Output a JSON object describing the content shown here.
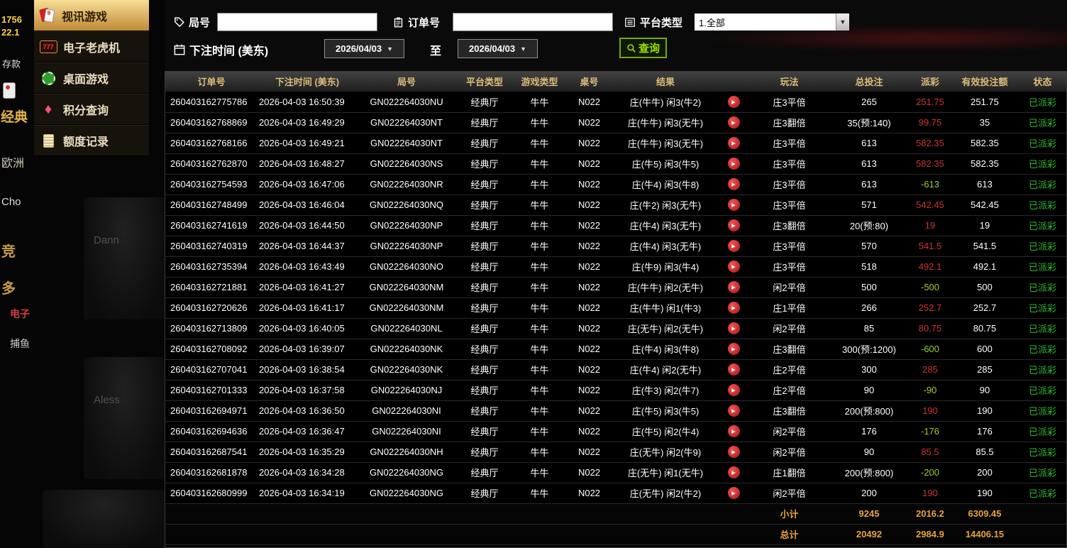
{
  "colors": {
    "gold_accent": "#e9b54d",
    "sidebar_active_gradient_top": "#f8de96",
    "sidebar_active_gradient_bottom": "#bf8a38",
    "header_text": "#dcbd7a",
    "payout_win_red": "#cc3333",
    "payout_loss_green": "#9ccf34",
    "status_paid_green": "#2eb82e",
    "query_button_green": "#6fae00",
    "totals_orange": "#e8a33d"
  },
  "background": {
    "left_strip": [
      {
        "text": "1756"
      },
      {
        "text": "22.1"
      },
      {
        "text": "存款"
      },
      {
        "text": "经典"
      },
      {
        "text": "欧洲"
      },
      {
        "text": "Cho"
      },
      {
        "text": "竞"
      },
      {
        "text": "多"
      },
      {
        "text": "电子"
      },
      {
        "text": "捕鱼"
      }
    ],
    "portraits": [
      {
        "name": "Dann"
      },
      {
        "name": "Aless"
      }
    ]
  },
  "sidebar": {
    "items": [
      {
        "label": "视讯游戏",
        "icon": "cards-icon",
        "active": true
      },
      {
        "label": "电子老虎机",
        "icon": "slot-icon",
        "icon_text": "777",
        "active": false
      },
      {
        "label": "桌面游戏",
        "icon": "chip-icon",
        "active": false
      },
      {
        "label": "积分查询",
        "icon": "diamond-icon",
        "active": false
      },
      {
        "label": "额度记录",
        "icon": "document-icon",
        "active": false
      }
    ]
  },
  "filters": {
    "round_label": "局号",
    "round_value": "",
    "order_label": "订单号",
    "order_value": "",
    "platform_label": "平台类型",
    "platform_selected": "1.全部",
    "bet_time_label": "下注时间 (美东)",
    "date_from": "2026/04/03",
    "to_label": "至",
    "date_to": "2026/04/03",
    "query_label": "查询"
  },
  "table": {
    "headers": [
      "订单号",
      "下注时间 (美东)",
      "局号",
      "平台类型",
      "游戏类型",
      "桌号",
      "结果",
      "",
      "玩法",
      "总投注",
      "派彩",
      "有效投注额",
      "状态"
    ],
    "rows": [
      {
        "order": "260403162775786",
        "time": "2026-04-03 16:50:39",
        "round": "GN022264030NU",
        "platform": "经典厅",
        "game": "牛牛",
        "table_no": "N022",
        "result": "庄(牛牛) 闲3(牛2)",
        "method": "庄3平倍",
        "total_bet": "265",
        "payout": "251.75",
        "valid_bet": "251.75",
        "status": "已派彩"
      },
      {
        "order": "260403162768869",
        "time": "2026-04-03 16:49:29",
        "round": "GN022264030NT",
        "platform": "经典厅",
        "game": "牛牛",
        "table_no": "N022",
        "result": "庄(牛牛) 闲3(无牛)",
        "method": "庄3翻倍",
        "total_bet": "35(预:140)",
        "payout": "99.75",
        "valid_bet": "35",
        "status": "已派彩"
      },
      {
        "order": "260403162768166",
        "time": "2026-04-03 16:49:21",
        "round": "GN022264030NT",
        "platform": "经典厅",
        "game": "牛牛",
        "table_no": "N022",
        "result": "庄(牛牛) 闲3(无牛)",
        "method": "庄3平倍",
        "total_bet": "613",
        "payout": "582.35",
        "valid_bet": "582.35",
        "status": "已派彩"
      },
      {
        "order": "260403162762870",
        "time": "2026-04-03 16:48:27",
        "round": "GN022264030NS",
        "platform": "经典厅",
        "game": "牛牛",
        "table_no": "N022",
        "result": "庄(牛5) 闲3(牛5)",
        "method": "庄3平倍",
        "total_bet": "613",
        "payout": "582.35",
        "valid_bet": "582.35",
        "status": "已派彩"
      },
      {
        "order": "260403162754593",
        "time": "2026-04-03 16:47:06",
        "round": "GN022264030NR",
        "platform": "经典厅",
        "game": "牛牛",
        "table_no": "N022",
        "result": "庄(牛4) 闲3(牛8)",
        "method": "庄3平倍",
        "total_bet": "613",
        "payout": "-613",
        "valid_bet": "613",
        "status": "已派彩"
      },
      {
        "order": "260403162748499",
        "time": "2026-04-03 16:46:04",
        "round": "GN022264030NQ",
        "platform": "经典厅",
        "game": "牛牛",
        "table_no": "N022",
        "result": "庄(牛2) 闲3(无牛)",
        "method": "庄3平倍",
        "total_bet": "571",
        "payout": "542.45",
        "valid_bet": "542.45",
        "status": "已派彩"
      },
      {
        "order": "260403162741619",
        "time": "2026-04-03 16:44:50",
        "round": "GN022264030NP",
        "platform": "经典厅",
        "game": "牛牛",
        "table_no": "N022",
        "result": "庄(牛4) 闲3(无牛)",
        "method": "庄3翻倍",
        "total_bet": "20(预:80)",
        "payout": "19",
        "valid_bet": "19",
        "status": "已派彩"
      },
      {
        "order": "260403162740319",
        "time": "2026-04-03 16:44:37",
        "round": "GN022264030NP",
        "platform": "经典厅",
        "game": "牛牛",
        "table_no": "N022",
        "result": "庄(牛4) 闲3(无牛)",
        "method": "庄3平倍",
        "total_bet": "570",
        "payout": "541.5",
        "valid_bet": "541.5",
        "status": "已派彩"
      },
      {
        "order": "260403162735394",
        "time": "2026-04-03 16:43:49",
        "round": "GN022264030NO",
        "platform": "经典厅",
        "game": "牛牛",
        "table_no": "N022",
        "result": "庄(牛9) 闲3(牛4)",
        "method": "庄3平倍",
        "total_bet": "518",
        "payout": "492.1",
        "valid_bet": "492.1",
        "status": "已派彩"
      },
      {
        "order": "260403162721881",
        "time": "2026-04-03 16:41:27",
        "round": "GN022264030NM",
        "platform": "经典厅",
        "game": "牛牛",
        "table_no": "N022",
        "result": "庄(牛牛) 闲2(无牛)",
        "method": "闲2平倍",
        "total_bet": "500",
        "payout": "-500",
        "valid_bet": "500",
        "status": "已派彩"
      },
      {
        "order": "260403162720626",
        "time": "2026-04-03 16:41:17",
        "round": "GN022264030NM",
        "platform": "经典厅",
        "game": "牛牛",
        "table_no": "N022",
        "result": "庄(牛牛) 闲1(牛3)",
        "method": "庄1平倍",
        "total_bet": "266",
        "payout": "252.7",
        "valid_bet": "252.7",
        "status": "已派彩"
      },
      {
        "order": "260403162713809",
        "time": "2026-04-03 16:40:05",
        "round": "GN022264030NL",
        "platform": "经典厅",
        "game": "牛牛",
        "table_no": "N022",
        "result": "庄(无牛) 闲2(无牛)",
        "method": "闲2平倍",
        "total_bet": "85",
        "payout": "80.75",
        "valid_bet": "80.75",
        "status": "已派彩"
      },
      {
        "order": "260403162708092",
        "time": "2026-04-03 16:39:07",
        "round": "GN022264030NK",
        "platform": "经典厅",
        "game": "牛牛",
        "table_no": "N022",
        "result": "庄(牛4) 闲3(牛8)",
        "method": "庄3翻倍",
        "total_bet": "300(预:1200)",
        "payout": "-600",
        "valid_bet": "600",
        "status": "已派彩"
      },
      {
        "order": "260403162707041",
        "time": "2026-04-03 16:38:54",
        "round": "GN022264030NK",
        "platform": "经典厅",
        "game": "牛牛",
        "table_no": "N022",
        "result": "庄(牛4) 闲2(无牛)",
        "method": "庄2平倍",
        "total_bet": "300",
        "payout": "285",
        "valid_bet": "285",
        "status": "已派彩"
      },
      {
        "order": "260403162701333",
        "time": "2026-04-03 16:37:58",
        "round": "GN022264030NJ",
        "platform": "经典厅",
        "game": "牛牛",
        "table_no": "N022",
        "result": "庄(牛3) 闲2(牛7)",
        "method": "庄2平倍",
        "total_bet": "90",
        "payout": "-90",
        "valid_bet": "90",
        "status": "已派彩"
      },
      {
        "order": "260403162694971",
        "time": "2026-04-03 16:36:50",
        "round": "GN022264030NI",
        "platform": "经典厅",
        "game": "牛牛",
        "table_no": "N022",
        "result": "庄(牛5) 闲3(牛5)",
        "method": "庄3翻倍",
        "total_bet": "200(预:800)",
        "payout": "190",
        "valid_bet": "190",
        "status": "已派彩"
      },
      {
        "order": "260403162694636",
        "time": "2026-04-03 16:36:47",
        "round": "GN022264030NI",
        "platform": "经典厅",
        "game": "牛牛",
        "table_no": "N022",
        "result": "庄(牛5) 闲2(牛4)",
        "method": "闲2平倍",
        "total_bet": "176",
        "payout": "-176",
        "valid_bet": "176",
        "status": "已派彩"
      },
      {
        "order": "260403162687541",
        "time": "2026-04-03 16:35:29",
        "round": "GN022264030NH",
        "platform": "经典厅",
        "game": "牛牛",
        "table_no": "N022",
        "result": "庄(无牛) 闲2(牛9)",
        "method": "闲2平倍",
        "total_bet": "90",
        "payout": "85.5",
        "valid_bet": "85.5",
        "status": "已派彩"
      },
      {
        "order": "260403162681878",
        "time": "2026-04-03 16:34:28",
        "round": "GN022264030NG",
        "platform": "经典厅",
        "game": "牛牛",
        "table_no": "N022",
        "result": "庄(无牛) 闲1(无牛)",
        "method": "庄1翻倍",
        "total_bet": "200(预:800)",
        "payout": "-200",
        "valid_bet": "200",
        "status": "已派彩"
      },
      {
        "order": "260403162680999",
        "time": "2026-04-03 16:34:19",
        "round": "GN022264030NG",
        "platform": "经典厅",
        "game": "牛牛",
        "table_no": "N022",
        "result": "庄(无牛) 闲2(牛2)",
        "method": "闲2平倍",
        "total_bet": "200",
        "payout": "190",
        "valid_bet": "190",
        "status": "已派彩"
      }
    ],
    "subtotal": {
      "label": "小计",
      "total_bet": "9245",
      "payout": "2016.2",
      "valid_bet": "6309.45"
    },
    "grand_total": {
      "label": "总计",
      "total_bet": "20492",
      "payout": "2984.9",
      "valid_bet": "14406.15"
    }
  }
}
